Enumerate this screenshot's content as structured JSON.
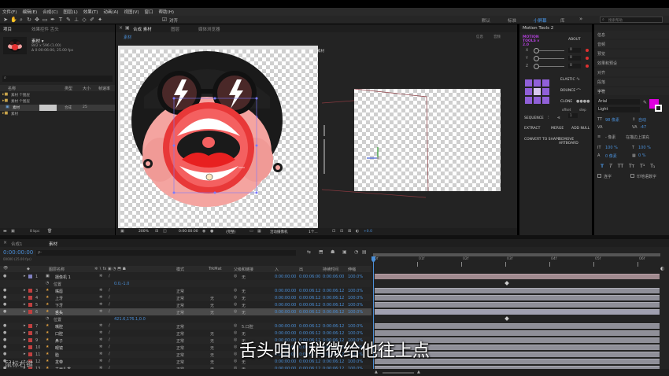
{
  "menu": [
    "文件(F)",
    "编辑(E)",
    "合成(C)",
    "图层(L)",
    "效果(T)",
    "动画(A)",
    "视图(V)",
    "窗口",
    "帮助(H)"
  ],
  "toolbar": {
    "snap_label": "对齐",
    "workspaces": [
      "默认",
      "标准",
      "小屏幕",
      "库"
    ],
    "search_placeholder": "搜索帮助"
  },
  "project": {
    "tab": "项目",
    "effects_tab": "效果控件 舌头",
    "comp_name": "素材 ▾",
    "comp_info_1": "842 x 596 (1.00)",
    "comp_info_2": "Δ 0:00:06:00, 25.00 fps",
    "search_icon_label": "⌕",
    "col_name": "名称",
    "col_type": "类型",
    "col_size": "大小",
    "col_fps": "帧速率",
    "items": [
      {
        "name": "素材 个图层",
        "type": "",
        "size": ""
      },
      {
        "name": "素材 个图层",
        "type": "",
        "size": ""
      },
      {
        "name": "素材",
        "type": "合成",
        "size": "25"
      },
      {
        "name": "素材",
        "type": "",
        "size": ""
      }
    ],
    "footer_bpc": "8 bpc"
  },
  "viewer": {
    "tab_comp": "合成 素材",
    "tab_layer": "图层",
    "tab_footage": "媒体浏览器",
    "comp_label": "素材",
    "zoom": "200%",
    "timecode": "0:00:00:00",
    "quality": "(完整)",
    "camera": "活动摄像机",
    "views": "1个...",
    "exposure": "+0.0",
    "info_tab": "信息",
    "audio_tab": "音频",
    "corner_label": "素材"
  },
  "motion_tools": {
    "title": "Motion Tools 2",
    "logo": "MOTION TOOLS v 2.0",
    "about": "ABOUT",
    "axes": [
      "X",
      "Y",
      "Z"
    ],
    "values": [
      "0",
      "0",
      "0"
    ],
    "elastic": "ELASTIC",
    "bounce": "BOUNCE",
    "clone": "CLONE",
    "offset": "offset",
    "step": "step",
    "step_value": "1",
    "sequence": "SEQUENCE",
    "extract": "EXTRACT",
    "merge": "MERGE",
    "add_null": "ADD NULL",
    "convert": "CONVERT TO SHAPE",
    "remove_artboard": "REMOVE ARTBOARD"
  },
  "right_panels": {
    "items": [
      "信息",
      "音频",
      "预览",
      "效果和预设",
      "对齐",
      "段落",
      "字符"
    ],
    "font": "Arial",
    "style": "Light",
    "size_label": "98 像素",
    "leading": "自动",
    "tracking": "-47",
    "stroke": "- 像素",
    "stroke_mode": "在描边上填充",
    "scale_h": "100 %",
    "scale_v": "100 %",
    "baseline": "0 像素",
    "tsume": "0 %",
    "ligature": "连字",
    "hindi": "印地语数字",
    "accent_fill": "#e000e0",
    "accent_stroke": "#ffffff"
  },
  "timeline": {
    "tab_render": "合成1",
    "tab_comp": "素材",
    "timecode": "0:00:00:00",
    "timecode_sub": "00000 (25.00 fps)",
    "search_placeholder": "ρ-",
    "headers": {
      "name": "图层名称",
      "mode": "模式",
      "trkmat": "TrkMat",
      "parent": "父级和链接",
      "in": "入",
      "out": "出",
      "duration": "持续时间",
      "stretch": "伸缩"
    },
    "ruler": [
      "0f",
      "01f",
      "02f",
      "03f",
      "04f",
      "05f",
      "06f"
    ],
    "layers": [
      {
        "num": "1",
        "name": "摄像机 1",
        "mode": "",
        "trk": "",
        "parent": "无",
        "in": "0:00:00:00",
        "out": "0:00:06:00",
        "dur": "0:00:06:00",
        "stretch": "100.0%",
        "type": "camera"
      },
      {
        "num": "",
        "name": "位置",
        "mode": "",
        "trk": "",
        "parent": "",
        "in": "",
        "out": "",
        "dur": "",
        "stretch": "",
        "type": "prop",
        "value": "0.0,-1.0"
      },
      {
        "num": "3",
        "name": "嘴唇",
        "mode": "正常",
        "trk": "",
        "parent": "无",
        "in": "0:00:00:00",
        "out": "0:00:06:12",
        "dur": "0:00:06:12",
        "stretch": "100.0%",
        "type": "layer"
      },
      {
        "num": "4",
        "name": "上牙",
        "mode": "正常",
        "trk": "无",
        "parent": "无",
        "in": "0:00:00:00",
        "out": "0:00:06:12",
        "dur": "0:00:06:12",
        "stretch": "100.0%",
        "type": "layer"
      },
      {
        "num": "5",
        "name": "下牙",
        "mode": "正常",
        "trk": "无",
        "parent": "无",
        "in": "0:00:00:00",
        "out": "0:00:06:12",
        "dur": "0:00:06:12",
        "stretch": "100.0%",
        "type": "layer"
      },
      {
        "num": "6",
        "name": "舌头",
        "mode": "正常",
        "trk": "无",
        "parent": "无",
        "in": "0:00:00:00",
        "out": "0:00:06:12",
        "dur": "0:00:06:12",
        "stretch": "100.0%",
        "type": "selected"
      },
      {
        "num": "",
        "name": "位置",
        "mode": "",
        "trk": "",
        "parent": "",
        "in": "",
        "out": "",
        "dur": "",
        "stretch": "",
        "type": "prop",
        "value": "421.6,176.1,0.0"
      },
      {
        "num": "7",
        "name": "嘴腔",
        "mode": "正常",
        "trk": "",
        "parent": "5.口腔",
        "in": "0:00:00:00",
        "out": "0:00:06:12",
        "dur": "0:00:06:12",
        "stretch": "100.0%",
        "type": "layer"
      },
      {
        "num": "8",
        "name": "口腔",
        "mode": "正常",
        "trk": "无",
        "parent": "无",
        "in": "0:00:00:00",
        "out": "0:00:06:12",
        "dur": "0:00:06:12",
        "stretch": "100.0%",
        "type": "layer"
      },
      {
        "num": "9",
        "name": "鼻子",
        "mode": "正常",
        "trk": "无",
        "parent": "无",
        "in": "0:00:00:00",
        "out": "0:00:06:12",
        "dur": "0:00:06:12",
        "stretch": "100.0%",
        "type": "layer"
      },
      {
        "num": "10",
        "name": "眼镜",
        "mode": "正常",
        "trk": "无",
        "parent": "无",
        "in": "0:00:00:00",
        "out": "0:00:06:12",
        "dur": "0:00:06:12",
        "stretch": "100.0%",
        "type": "layer"
      },
      {
        "num": "11",
        "name": "脸",
        "mode": "正常",
        "trk": "无",
        "parent": "无",
        "in": "0:00:00:00",
        "out": "0:00:06:12",
        "dur": "0:00:06:12",
        "stretch": "100.0%",
        "type": "layer"
      },
      {
        "num": "12",
        "name": "发带",
        "mode": "正常",
        "trk": "无",
        "parent": "无",
        "in": "0:00:00:00",
        "out": "0:00:06:12",
        "dur": "0:00:06:12",
        "stretch": "100.0%",
        "type": "layer"
      },
      {
        "num": "13",
        "name": "主画头发",
        "mode": "正常",
        "trk": "无",
        "parent": "无",
        "in": "0:00:00:00",
        "out": "0:00:06:12",
        "dur": "0:00:06:12",
        "stretch": "100.0%",
        "type": "layer"
      }
    ]
  },
  "subtitle": "舌头咱们稍微给他往上点",
  "watermark": "鼠标右键"
}
